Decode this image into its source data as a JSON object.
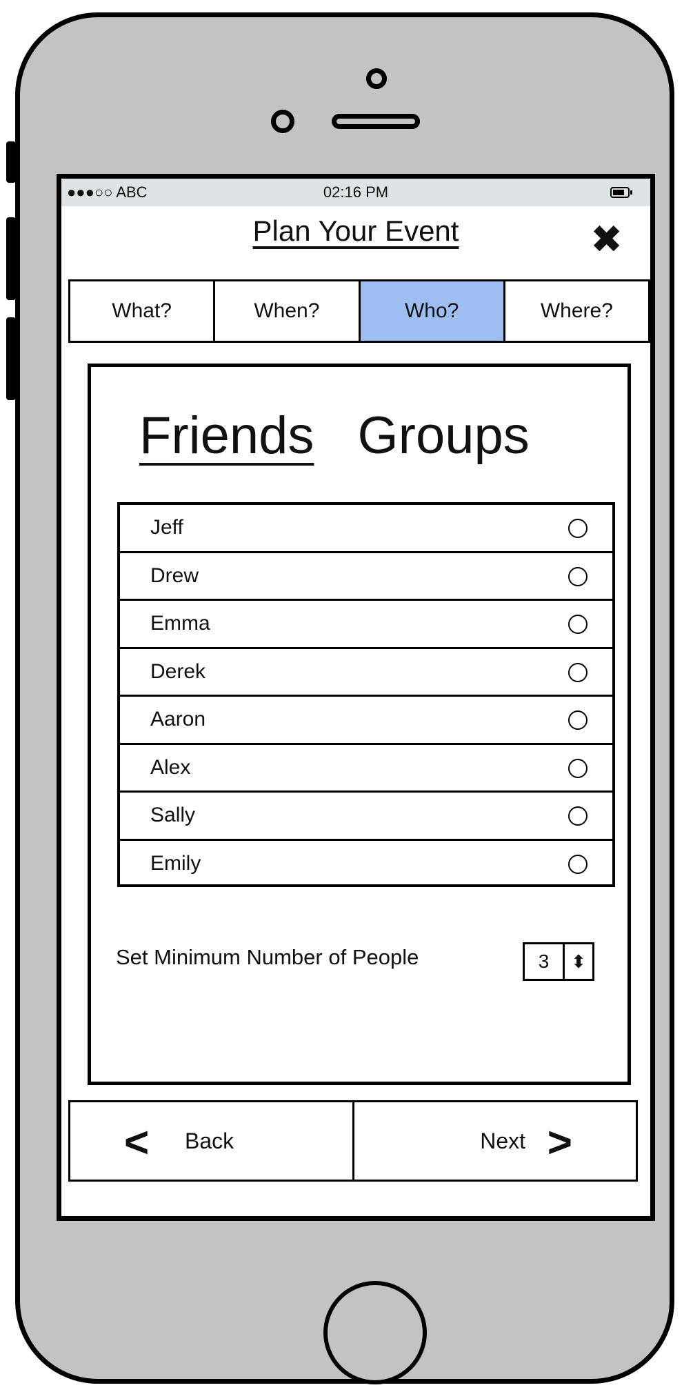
{
  "status_bar": {
    "carrier": "●●●○○ ABC",
    "time": "02:16 PM",
    "battery_icon": "battery-icon"
  },
  "header": {
    "title": "Plan Your Event",
    "close_icon": "close-icon"
  },
  "tabs": [
    {
      "label": "What?",
      "active": false
    },
    {
      "label": "When?",
      "active": false
    },
    {
      "label": "Who?",
      "active": true
    },
    {
      "label": "Where?",
      "active": false
    }
  ],
  "segments": [
    {
      "label": "Friends",
      "selected": true
    },
    {
      "label": "Groups",
      "selected": false
    }
  ],
  "friends": [
    {
      "name": "Jeff"
    },
    {
      "name": "Drew"
    },
    {
      "name": "Emma"
    },
    {
      "name": "Derek"
    },
    {
      "name": "Aaron"
    },
    {
      "name": "Alex"
    },
    {
      "name": "Sally"
    },
    {
      "name": "Emily"
    }
  ],
  "minimum": {
    "label": "Set Minimum Number of People",
    "value": "3"
  },
  "nav": {
    "back_label": "Back",
    "next_label": "Next"
  },
  "colors": {
    "active_tab": "#9ebdf0",
    "phone_body": "#c3c3c3",
    "status_bar": "#dde2e5"
  }
}
